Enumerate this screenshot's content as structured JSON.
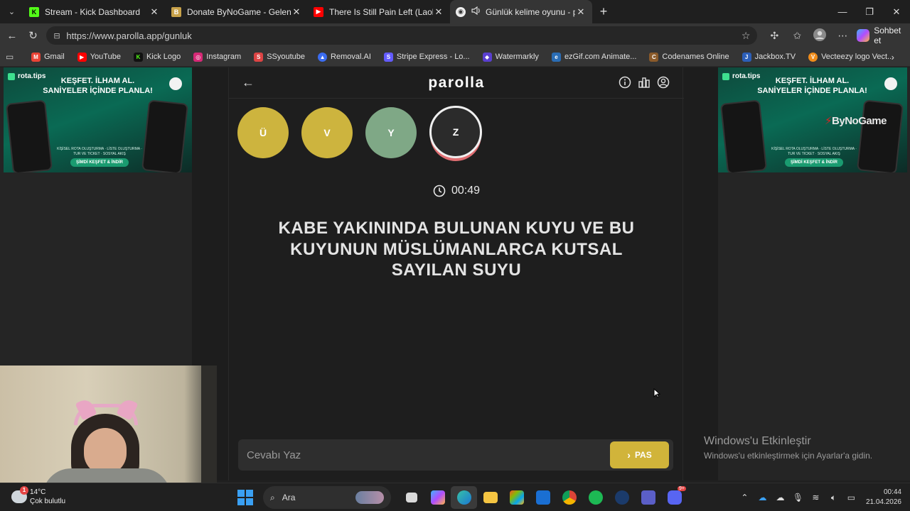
{
  "browser": {
    "tabs": [
      {
        "title": "Stream - Kick Dashboard",
        "icon": "kick-icon",
        "color": "#53fc18",
        "active": false
      },
      {
        "title": "Donate ByNoGame - Gelen/Giden",
        "icon": "bynogame-icon",
        "color": "#c8a24a",
        "active": false
      },
      {
        "title": "There Is Still Pain Left (Laolu Remix)",
        "icon": "youtube-icon",
        "color": "#ff0000",
        "active": false
      },
      {
        "title": "Günlük kelime oyunu - parolla",
        "icon": "parolla-icon",
        "color": "#eeeeee",
        "active": true
      }
    ],
    "url": "https://www.parolla.app/gunluk",
    "copilot_label": "Sohbet et",
    "bookmarks": [
      {
        "label": "Gmail",
        "color": "#ea4335"
      },
      {
        "label": "YouTube",
        "color": "#ff0000"
      },
      {
        "label": "Kick Logo",
        "color": "#53fc18"
      },
      {
        "label": "Instagram",
        "color": "#d62976"
      },
      {
        "label": "SSyoutube",
        "color": "#d44"
      },
      {
        "label": "Removal.AI",
        "color": "#3b6cf0"
      },
      {
        "label": "Stripe Express - Lo...",
        "color": "#635bff"
      },
      {
        "label": "Watermarkly",
        "color": "#5a3fd1"
      },
      {
        "label": "ezGif.com Animate...",
        "color": "#2a6db5"
      },
      {
        "label": "Codenames Online",
        "color": "#8a5a2a"
      },
      {
        "label": "Jackbox.TV",
        "color": "#2c5fb8"
      },
      {
        "label": "Vecteezy logo Vect...",
        "color": "#f08c1a"
      }
    ]
  },
  "ads": {
    "brand": "rota.tips",
    "headline_1": "KEŞFET. İLHAM AL.",
    "headline_2": "SANİYELER İÇİNDE PLANLA!",
    "cta": "ŞİMDİ KEŞFET & İNDİR",
    "tagline": "KİŞİSEL ROTA OLUŞTURMA · LİSTE OLUŞTURMA · TUR VE TICKET · SOSYAL AKIŞ",
    "watermark": "ByNoGame"
  },
  "game": {
    "logo": "parolla",
    "letters": [
      {
        "char": "Ü",
        "state": "correct"
      },
      {
        "char": "V",
        "state": "correct"
      },
      {
        "char": "Y",
        "state": "passed"
      },
      {
        "char": "Z",
        "state": "current"
      }
    ],
    "timer": "00:49",
    "question": "KABE YAKININDA BULUNAN KUYU VE BU KUYUNUN MÜSLÜMANLARCA KUTSAL SAYILAN SUYU",
    "answer_placeholder": "Cevabı Yaz",
    "pass_label": "PAS",
    "colors": {
      "correct": "#cdb43e",
      "passed": "#7fa886",
      "current_ring": "#e06e72"
    }
  },
  "activation": {
    "title": "Windows'u Etkinleştir",
    "subtitle": "Windows'u etkinleştirmek için Ayarlar'a gidin."
  },
  "taskbar": {
    "temperature": "14°C",
    "weather": "Çok bulutlu",
    "weather_badge": "1",
    "search_label": "Ara",
    "time": "00:44",
    "date": "21.04.2026",
    "discord_badge": "9+"
  }
}
